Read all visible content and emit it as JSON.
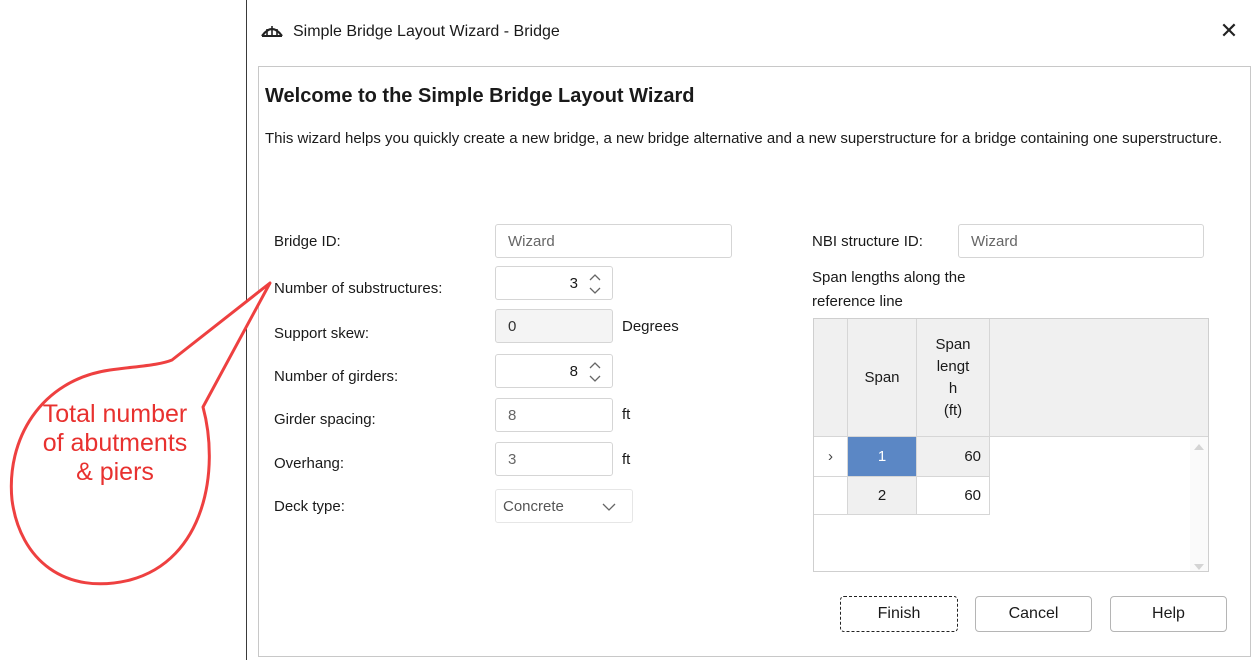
{
  "window": {
    "title": "Simple Bridge Layout Wizard - Bridge",
    "close_glyph": "✕",
    "app_icon": "bridge-icon"
  },
  "heading": "Welcome to the Simple Bridge Layout Wizard",
  "description": "This wizard helps you quickly create a new bridge, a new bridge alternative and a new superstructure for a bridge containing one superstructure.",
  "form": {
    "bridge_id": {
      "label": "Bridge ID:",
      "placeholder": "Wizard"
    },
    "num_substructures": {
      "label": "Number of substructures:",
      "value": "3"
    },
    "support_skew": {
      "label": "Support skew:",
      "value": "0",
      "unit": "Degrees"
    },
    "num_girders": {
      "label": "Number of girders:",
      "value": "8"
    },
    "girder_spacing": {
      "label": "Girder spacing:",
      "value": "8",
      "unit": "ft"
    },
    "overhang": {
      "label": "Overhang:",
      "value": "3",
      "unit": "ft"
    },
    "deck_type": {
      "label": "Deck type:",
      "value": "Concrete"
    },
    "nbi_structure_id": {
      "label": "NBI structure ID:",
      "placeholder": "Wizard"
    }
  },
  "span_table": {
    "caption_line1": "Span lengths along the",
    "caption_line2": "reference line",
    "columns": [
      "Span",
      "Span\nlengt\nh\n(ft)"
    ],
    "rows": [
      {
        "indicator": "›",
        "span": "1",
        "length": "60"
      },
      {
        "indicator": "",
        "span": "2",
        "length": "60"
      }
    ]
  },
  "buttons": {
    "finish": "Finish",
    "cancel": "Cancel",
    "help": "Help"
  },
  "callout": {
    "text": "Total number of abutments & piers",
    "color": "#e8312f"
  },
  "colors": {
    "selected_row": "#5b87c5",
    "header_bg": "#f0f0f0"
  }
}
